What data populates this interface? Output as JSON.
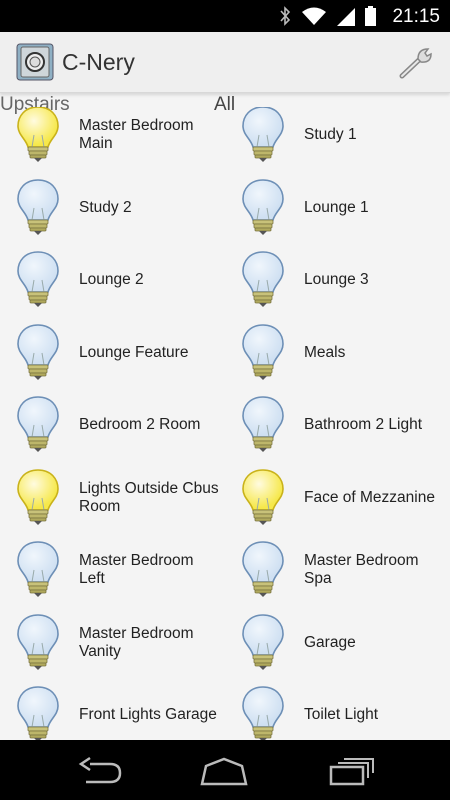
{
  "status_bar": {
    "time": "21:15",
    "icons": [
      "bluetooth-icon",
      "wifi-icon",
      "signal-icon",
      "battery-icon"
    ]
  },
  "action_bar": {
    "title": "C-Nery",
    "app_icon": "app-logo-icon",
    "settings_icon": "wrench-icon"
  },
  "tabs": {
    "upstairs": "Upstairs",
    "all": "All"
  },
  "lights": [
    {
      "label": "Master Bedroom Main",
      "state": "on"
    },
    {
      "label": "Study 1",
      "state": "off"
    },
    {
      "label": "Study 2",
      "state": "off"
    },
    {
      "label": "Lounge 1",
      "state": "off"
    },
    {
      "label": "Lounge 2",
      "state": "off"
    },
    {
      "label": "Lounge 3",
      "state": "off"
    },
    {
      "label": "Lounge Feature",
      "state": "off"
    },
    {
      "label": "Meals",
      "state": "off"
    },
    {
      "label": "Bedroom 2 Room",
      "state": "off"
    },
    {
      "label": "Bathroom 2 Light",
      "state": "off"
    },
    {
      "label": "Lights Outside Cbus Room",
      "state": "on"
    },
    {
      "label": "Face of Mezzanine",
      "state": "on"
    },
    {
      "label": "Master Bedroom Left",
      "state": "off"
    },
    {
      "label": "Master Bedroom Spa",
      "state": "off"
    },
    {
      "label": "Master Bedroom Vanity",
      "state": "off"
    },
    {
      "label": "Garage",
      "state": "off"
    },
    {
      "label": "Front Lights Garage",
      "state": "off"
    },
    {
      "label": "Toilet Light",
      "state": "off"
    }
  ],
  "colors": {
    "bulb_on": "#f6e84a",
    "bulb_off": "#cfe0f2",
    "status_bar": "#000000",
    "action_bar": "#efefef"
  },
  "nav_bar": {
    "icons": [
      "back-icon",
      "home-icon",
      "recent-apps-icon"
    ]
  }
}
